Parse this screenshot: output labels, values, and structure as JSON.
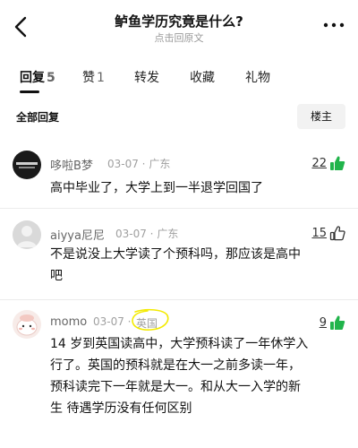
{
  "header": {
    "title": "鲈鱼学历究竟是什么?",
    "subtitle": "点击回原文",
    "back_icon": "chevron-left-icon",
    "more_icon": "more-dots-icon"
  },
  "tabs": [
    {
      "label": "回复",
      "count": "5"
    },
    {
      "label": "赞",
      "count": "1"
    },
    {
      "label": "转发",
      "count": ""
    },
    {
      "label": "收藏",
      "count": ""
    },
    {
      "label": "礼物",
      "count": ""
    }
  ],
  "section": {
    "title": "全部回复",
    "owner_button": "楼主"
  },
  "comments": [
    {
      "name": "哆啦B梦",
      "meta": "03-07 · 广东",
      "likes": "22",
      "text_lines": [
        "高中毕业了，大学上到一半退学回国了"
      ]
    },
    {
      "name": "aiyya尼尼",
      "meta": "03-07 · 广东",
      "likes": "15",
      "text_lines": [
        "不是说没上大学读了个预科吗，那应该是高中",
        "吧"
      ]
    },
    {
      "name": "momo",
      "meta_date": "03-07 ·",
      "meta_region": "英国",
      "likes": "9",
      "text_lines": [
        "14 岁到英国读高中，大学预科读了一年休学入",
        "行了。英国的预科就是在大一之前多读一年，",
        "预科读完下一年就是大一。和从大一入学的新",
        "生 待遇学历没有任何区别"
      ]
    }
  ],
  "colors": {
    "like_green": "#21b44b",
    "highlight_yellow": "#f3ea00"
  }
}
